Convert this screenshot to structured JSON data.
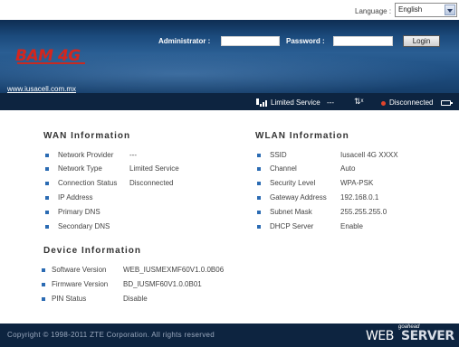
{
  "top": {
    "language_label": "Language :",
    "language_selected": "English"
  },
  "header": {
    "logo_text": "BAM 4G",
    "website": "www.iusacell.com.mx",
    "administrator_label": "Administrator :",
    "password_label": "Password :",
    "login_label": "Login"
  },
  "status": {
    "service": "Limited Service",
    "dashes": "---",
    "connection": "Disconnected",
    "connection_color": "#e0442c"
  },
  "wan": {
    "title": "WAN Information",
    "rows": [
      {
        "label": "Network Provider",
        "value": "---"
      },
      {
        "label": "Network Type",
        "value": "Limited Service"
      },
      {
        "label": "Connection Status",
        "value": "Disconnected"
      },
      {
        "label": "IP Address",
        "value": ""
      },
      {
        "label": "Primary DNS",
        "value": ""
      },
      {
        "label": "Secondary DNS",
        "value": ""
      }
    ]
  },
  "wlan": {
    "title": "WLAN Information",
    "rows": [
      {
        "label": "SSID",
        "value": "Iusacell 4G XXXX"
      },
      {
        "label": "Channel",
        "value": "Auto"
      },
      {
        "label": "Security Level",
        "value": "WPA-PSK"
      },
      {
        "label": "Gateway Address",
        "value": "192.168.0.1"
      },
      {
        "label": "Subnet Mask",
        "value": "255.255.255.0"
      },
      {
        "label": "DHCP Server",
        "value": "Enable"
      }
    ]
  },
  "device": {
    "title": "Device Information",
    "rows": [
      {
        "label": "Software Version",
        "value": "WEB_IUSMEXMF60V1.0.0B06"
      },
      {
        "label": "Firmware Version",
        "value": "BD_IUSMF60V1.0.0B01"
      },
      {
        "label": "PIN Status",
        "value": "Disable"
      }
    ]
  },
  "footer": {
    "copyright": "Copyright © 1998-2011 ZTE Corporation. All rights reserved",
    "badge_goahead": "goahead",
    "badge_web": "WEB",
    "badge_server": "SERVER"
  },
  "colors": {
    "header_blue": "#1b4a7c",
    "bar_navy": "#0d2440",
    "bullet_blue": "#2b6bb3",
    "logo_red": "#d4261e"
  }
}
